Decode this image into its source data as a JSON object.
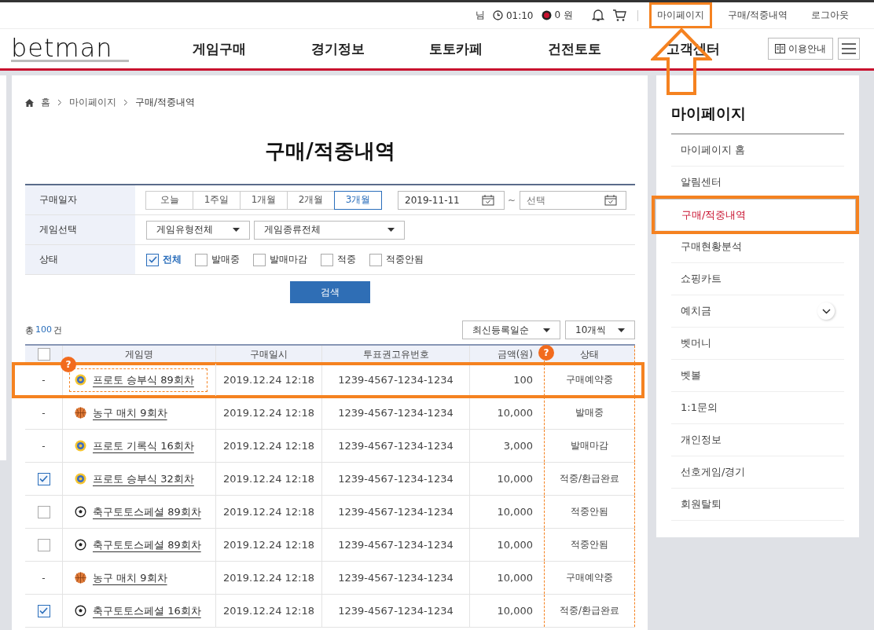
{
  "top_bar": {
    "user_suffix": "님",
    "timer": "01:10",
    "balance": "0 원",
    "links": [
      {
        "label": "마이페이지",
        "highlighted": true
      },
      {
        "label": "구매/적중내역",
        "highlighted": false
      },
      {
        "label": "로그아웃",
        "highlighted": false
      }
    ]
  },
  "logo": "betman",
  "nav": {
    "items": [
      "게임구매",
      "경기정보",
      "토토카페",
      "건전토토",
      "고객센터"
    ],
    "guide_button": "이용안내"
  },
  "breadcrumb": [
    "홈",
    "마이페이지",
    "구매/적중내역"
  ],
  "page_title": "구매/적중내역",
  "filters": {
    "date": {
      "label": "구매일자",
      "periods": [
        {
          "label": "오늘",
          "selected": false
        },
        {
          "label": "1주일",
          "selected": false
        },
        {
          "label": "1개월",
          "selected": false
        },
        {
          "label": "2개월",
          "selected": false
        },
        {
          "label": "3개월",
          "selected": true
        }
      ],
      "from": "2019-11-11",
      "separator": "~",
      "to_placeholder": "선택"
    },
    "game": {
      "label": "게임선택",
      "selects": [
        "게임유형전체",
        "게임종류전체"
      ]
    },
    "status": {
      "label": "상태",
      "options": [
        {
          "label": "전체",
          "checked": true
        },
        {
          "label": "발매중",
          "checked": false
        },
        {
          "label": "발매마감",
          "checked": false
        },
        {
          "label": "적중",
          "checked": false
        },
        {
          "label": "적중안됨",
          "checked": false
        }
      ]
    }
  },
  "search_button": "검색",
  "total": {
    "prefix": "총",
    "count": "100",
    "suffix": "건"
  },
  "sort_select": "최신등록일순",
  "page_size_select": "10개씩",
  "table": {
    "header_checked": false,
    "columns": [
      "게임명",
      "구매일시",
      "투표권고유번호",
      "금액(원)",
      "상태"
    ],
    "rows": [
      {
        "kind": "dash",
        "mark": "-",
        "game": {
          "kind": "proto",
          "name": "프로토 승부식 89회차"
        },
        "datetime": "2019.12.24 12:18",
        "ticket": "1239-4567-1234-1234",
        "amount": "100",
        "status": "구매예약중",
        "highlighted": true
      },
      {
        "kind": "dash",
        "mark": "-",
        "game": {
          "kind": "basketball",
          "name": "농구 매치 9회차"
        },
        "datetime": "2019.12.24 12:18",
        "ticket": "1239-4567-1234-1234",
        "amount": "10,000",
        "status": "발매중",
        "highlighted": false
      },
      {
        "kind": "dash",
        "mark": "-",
        "game": {
          "kind": "proto",
          "name": "프로토 기록식 16회차"
        },
        "datetime": "2019.12.24 12:18",
        "ticket": "1239-4567-1234-1234",
        "amount": "3,000",
        "status": "발매마감",
        "highlighted": false
      },
      {
        "kind": "checkbox",
        "checked": true,
        "game": {
          "kind": "proto",
          "name": "프로토 승부식 32회차"
        },
        "datetime": "2019.12.24 12:18",
        "ticket": "1239-4567-1234-1234",
        "amount": "10,000",
        "status": "적중/환급완료",
        "highlighted": false
      },
      {
        "kind": "checkbox",
        "checked": false,
        "game": {
          "kind": "soccer",
          "name": "축구토토스페셜 89회차"
        },
        "datetime": "2019.12.24 12:18",
        "ticket": "1239-4567-1234-1234",
        "amount": "10,000",
        "status": "적중안됨",
        "highlighted": false
      },
      {
        "kind": "checkbox",
        "checked": false,
        "game": {
          "kind": "soccer",
          "name": "축구토토스페셜 89회차"
        },
        "datetime": "2019.12.24 12:18",
        "ticket": "1239-4567-1234-1234",
        "amount": "10,000",
        "status": "적중안됨",
        "highlighted": false
      },
      {
        "kind": "dash",
        "mark": "-",
        "game": {
          "kind": "basketball",
          "name": "농구 매치 9회차"
        },
        "datetime": "2019.12.24 12:18",
        "ticket": "1239-4567-1234-1234",
        "amount": "10,000",
        "status": "구매예약중",
        "highlighted": false
      },
      {
        "kind": "checkbox",
        "checked": true,
        "game": {
          "kind": "soccer",
          "name": "축구토토스페셜 16회차"
        },
        "datetime": "2019.12.24 12:18",
        "ticket": "1239-4567-1234-1234",
        "amount": "10,000",
        "status": "적중/환급완료",
        "highlighted": false
      }
    ]
  },
  "badges": {
    "game_cell": "?",
    "amount_header": "?"
  },
  "sidebar": {
    "title": "마이페이지",
    "items": [
      {
        "label": "마이페이지 홈",
        "selected": false,
        "highlighted": false,
        "expandable": false
      },
      {
        "label": "알림센터",
        "selected": false,
        "highlighted": false,
        "expandable": false
      },
      {
        "label": "구매/적중내역",
        "selected": true,
        "highlighted": true,
        "expandable": false
      },
      {
        "label": "구매현황분석",
        "selected": false,
        "highlighted": false,
        "expandable": false
      },
      {
        "label": "쇼핑카트",
        "selected": false,
        "highlighted": false,
        "expandable": false
      },
      {
        "label": "예치금",
        "selected": false,
        "highlighted": false,
        "expandable": true
      },
      {
        "label": "벳머니",
        "selected": false,
        "highlighted": false,
        "expandable": false
      },
      {
        "label": "벳볼",
        "selected": false,
        "highlighted": false,
        "expandable": false
      },
      {
        "label": "1:1문의",
        "selected": false,
        "highlighted": false,
        "expandable": false
      },
      {
        "label": "개인정보",
        "selected": false,
        "highlighted": false,
        "expandable": false
      },
      {
        "label": "선호게임/경기",
        "selected": false,
        "highlighted": false,
        "expandable": false
      },
      {
        "label": "회원탈퇴",
        "selected": false,
        "highlighted": false,
        "expandable": false
      }
    ]
  }
}
